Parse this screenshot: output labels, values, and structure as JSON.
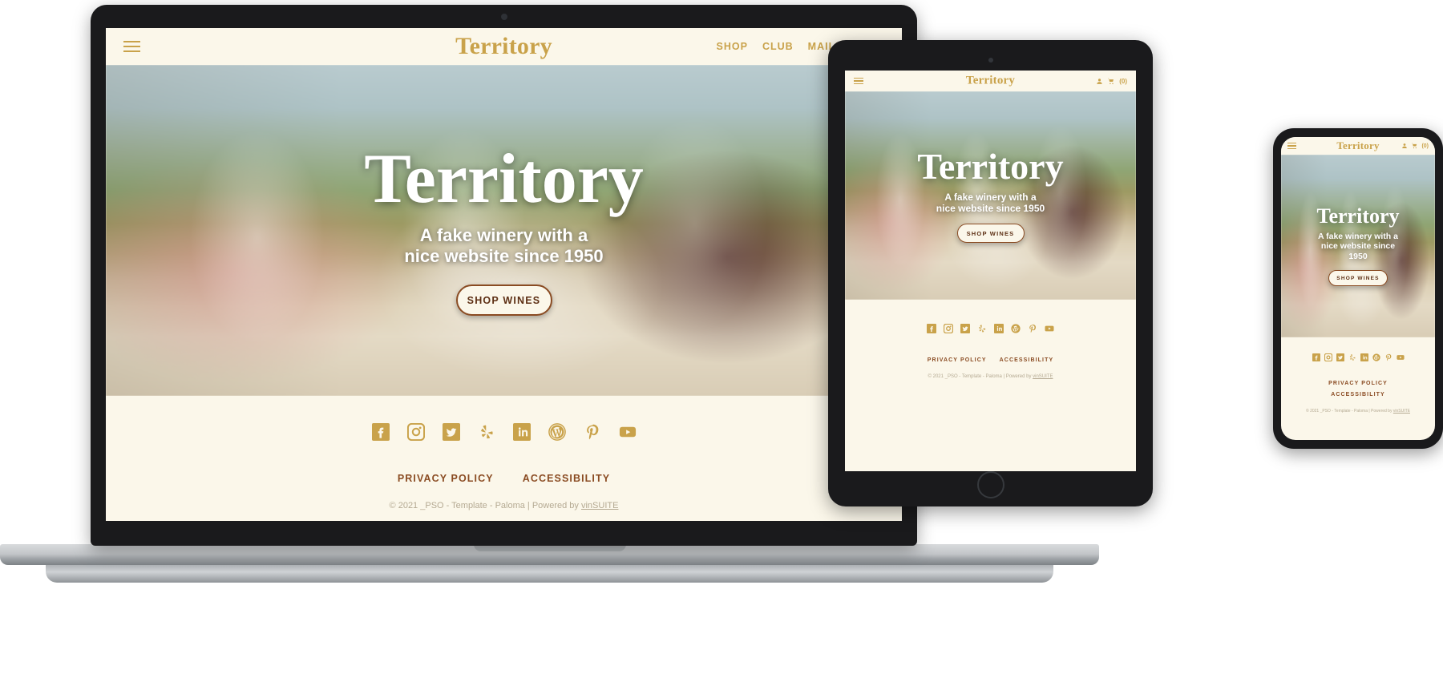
{
  "brand": {
    "name": "Territory",
    "accent": "#c9a24a",
    "cream": "#fbf7ea",
    "link": "#8a4b22"
  },
  "laptop": {
    "header": {
      "logo": "Territory",
      "menu_icon": "hamburger-icon",
      "nav": [
        {
          "label": "SHOP"
        },
        {
          "label": "CLUB"
        },
        {
          "label": "MAILING LIST"
        }
      ]
    },
    "hero": {
      "title": "Territory",
      "subtitle_lines": [
        "A fake winery with a",
        "nice website since 1950"
      ],
      "cta": "SHOP WINES"
    },
    "footer": {
      "socials": [
        "facebook-icon",
        "instagram-icon",
        "twitter-icon",
        "yelp-icon",
        "linkedin-icon",
        "wordpress-icon",
        "pinterest-icon",
        "youtube-icon"
      ],
      "links": [
        {
          "label": "PRIVACY POLICY"
        },
        {
          "label": "ACCESSIBILITY"
        }
      ],
      "copyright_prefix": "© 2021 _PSO - Template - Paloma | Powered by ",
      "copyright_vendor": "vinSUITE"
    }
  },
  "tablet": {
    "header": {
      "logo": "Territory",
      "menu_icon": "hamburger-icon",
      "account_icon": "user-icon",
      "cart_icon": "cart-icon",
      "cart_count": "(0)"
    },
    "hero": {
      "title": "Territory",
      "subtitle_lines": [
        "A fake winery with a",
        "nice website since 1950"
      ],
      "cta": "SHOP WINES"
    },
    "footer": {
      "socials": [
        "facebook-icon",
        "instagram-icon",
        "twitter-icon",
        "yelp-icon",
        "linkedin-icon",
        "wordpress-icon",
        "pinterest-icon",
        "youtube-icon"
      ],
      "links": [
        {
          "label": "PRIVACY POLICY"
        },
        {
          "label": "ACCESSIBILITY"
        }
      ],
      "copyright_prefix": "© 2021 _PSO - Template - Paloma | Powered by ",
      "copyright_vendor": "vinSUITE"
    }
  },
  "phone": {
    "header": {
      "logo": "Territory",
      "menu_icon": "hamburger-icon",
      "account_icon": "user-icon",
      "cart_icon": "cart-icon",
      "cart_count": "(0)"
    },
    "hero": {
      "title": "Territory",
      "subtitle_lines": [
        "A fake winery with a",
        "nice website since",
        "1950"
      ],
      "cta": "SHOP WINES"
    },
    "footer": {
      "socials": [
        "facebook-icon",
        "instagram-icon",
        "twitter-icon",
        "yelp-icon",
        "linkedin-icon",
        "wordpress-icon",
        "pinterest-icon",
        "youtube-icon"
      ],
      "links": [
        {
          "label": "PRIVACY POLICY"
        },
        {
          "label": "ACCESSIBILITY"
        }
      ],
      "copyright_prefix": "© 2021 _PSO - Template - Paloma | Powered by ",
      "copyright_vendor": "vinSUITE"
    }
  }
}
